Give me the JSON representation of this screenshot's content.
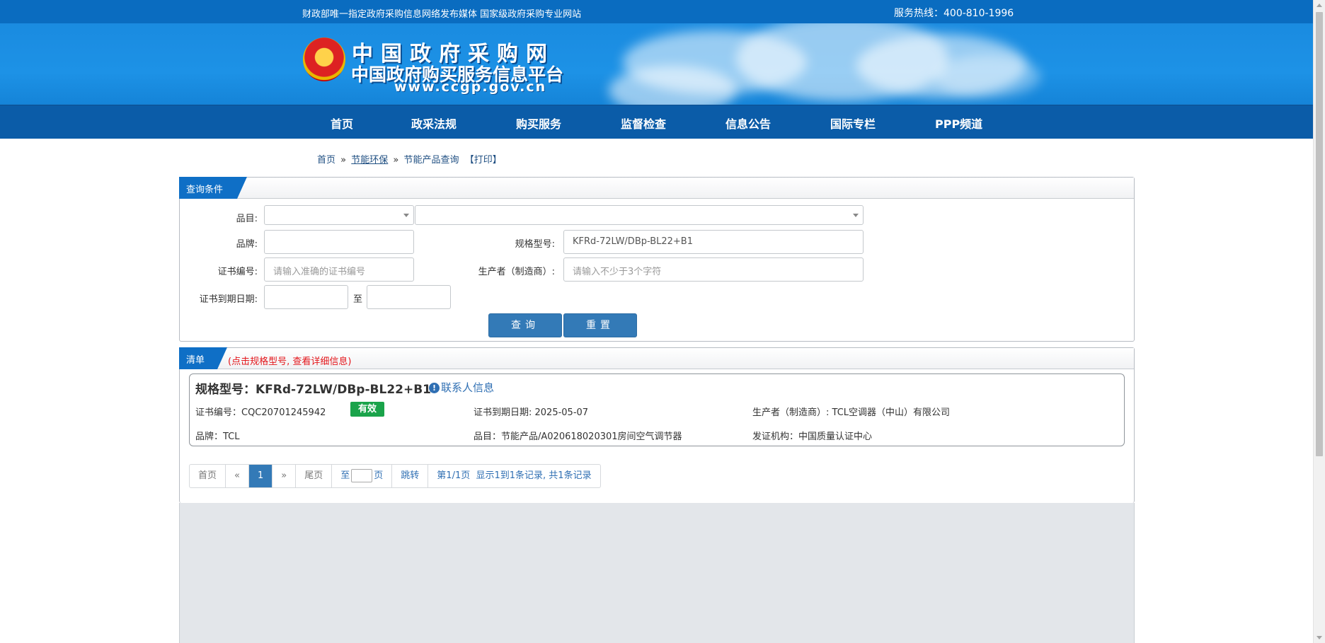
{
  "topbar": {
    "left_text": "财政部唯一指定政府采购信息网络发布媒体 国家级政府采购专业网站",
    "hotline": "服务热线：400-810-1996"
  },
  "logo": {
    "title": "中国政府采购网",
    "subtitle": "中国政府购买服务信息平台",
    "url": "www.ccgp.gov.cn"
  },
  "nav": [
    "首页",
    "政采法规",
    "购买服务",
    "监督检查",
    "信息公告",
    "国际专栏",
    "PPP频道"
  ],
  "breadcrumb": {
    "home": "首页",
    "sep": "»",
    "section": "节能环保",
    "current": "节能产品查询",
    "print": "【打印】"
  },
  "query": {
    "tab": "查询条件",
    "category_label": "品目:",
    "category1_value": "",
    "category2_value": "",
    "brand_label": "品牌:",
    "brand_value": "",
    "model_label": "规格型号:",
    "model_value": "KFRd-72LW/DBp-BL22+B1",
    "cert_label": "证书编号:",
    "cert_placeholder": "请输入准确的证书编号",
    "maker_label": "生产者（制造商）:",
    "maker_placeholder": "请输入不少于3个字符",
    "expiry_label": "证书到期日期:",
    "expiry_to": "至",
    "search_button": "查询",
    "reset_button": "重置"
  },
  "list": {
    "tab": "清单",
    "hint": "(点击规格型号, 查看详细信息)",
    "result": {
      "title": "规格型号：KFRd-72LW/DBp-BL22+B1",
      "contact": "联系人信息",
      "cert_no": "证书编号：CQC20701245942",
      "status": "有效",
      "expiry": "证书到期日期: 2025-05-07",
      "maker": "生产者（制造商）: TCL空调器（中山）有限公司",
      "brand": "品牌：TCL",
      "category": "品目：节能产品/A020618020301房间空气调节器",
      "issuer": "发证机构：中国质量认证中心"
    }
  },
  "pager": {
    "first": "首页",
    "prev": "«",
    "current": "1",
    "next": "»",
    "last": "尾页",
    "goto_prefix": "至",
    "goto_suffix": "页",
    "jump": "跳转",
    "page_info": "第1/1页",
    "records": "显示1到1条记录, 共1条记录"
  },
  "colors": {
    "topbar": "#0a6cc0",
    "nav": "#0b5ca8",
    "accent": "#337ab7",
    "valid_badge": "#1aa34a",
    "hint_red": "#e4161b"
  }
}
